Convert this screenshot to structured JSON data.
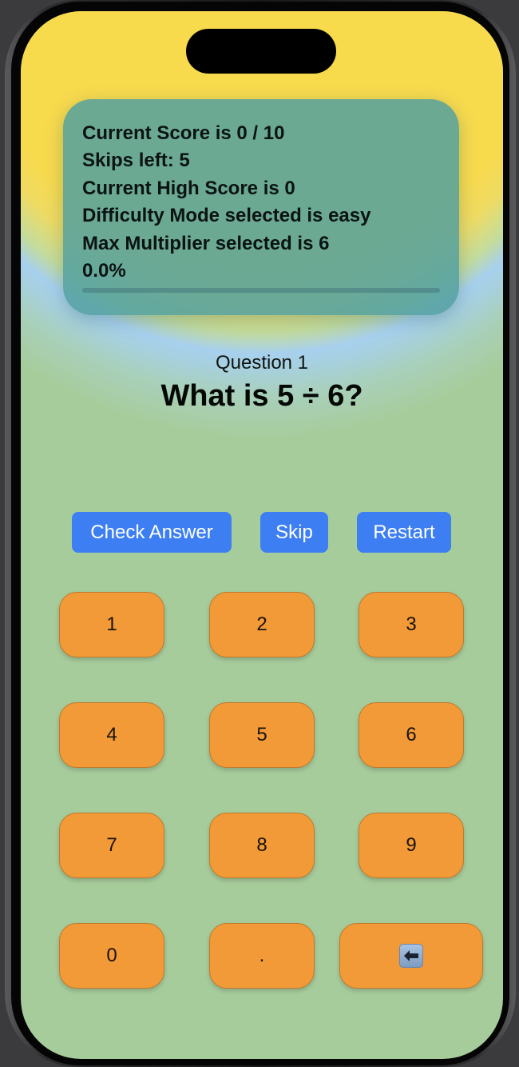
{
  "stats": {
    "score_line": "Current Score is 0 / 10",
    "skips_line": "Skips left: 5",
    "high_score_line": "Current High Score is 0",
    "difficulty_line": "Difficulty Mode selected is easy",
    "multiplier_line": "Max Multiplier selected is 6",
    "progress_text": "0.0%",
    "progress_fraction": 0.0
  },
  "question": {
    "label": "Question 1",
    "text": "What is 5 ÷ 6?"
  },
  "actions": {
    "check_label": "Check Answer",
    "skip_label": "Skip",
    "restart_label": "Restart"
  },
  "keypad": {
    "keys": [
      "1",
      "2",
      "3",
      "4",
      "5",
      "6",
      "7",
      "8",
      "9",
      "0",
      "."
    ],
    "backspace_icon": "left-arrow-icon"
  },
  "colors": {
    "action_blue": "#3d7ff3",
    "key_orange": "#f19a37",
    "card_teal": "#52a0a0",
    "background_green": "#a7cc9c",
    "glow_yellow": "#f8da4d"
  }
}
